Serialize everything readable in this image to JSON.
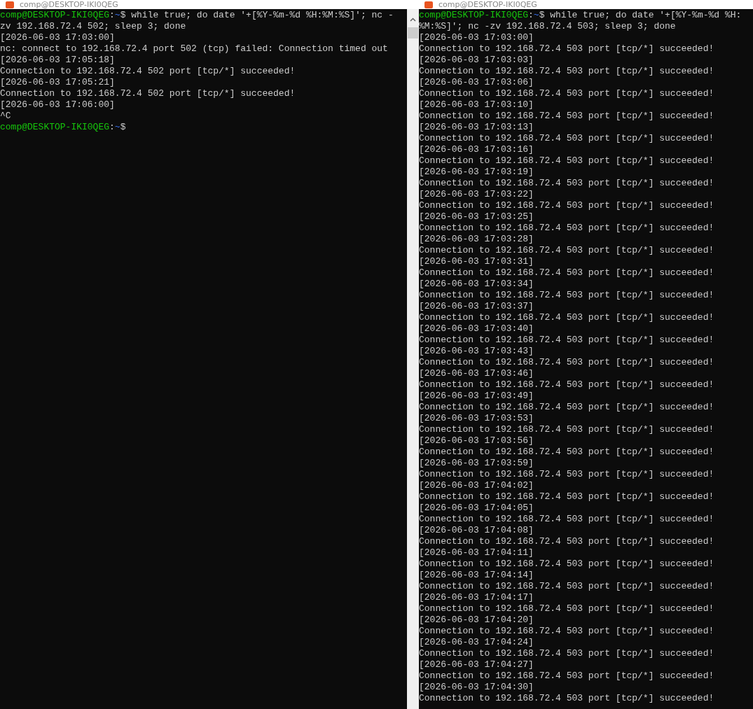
{
  "windows": [
    {
      "title": "comp@DESKTOP-IKI0QEG",
      "scrollbar": true,
      "lines": [
        {
          "kind": "prompt",
          "user_host": "comp@DESKTOP-IKI0QEG",
          "separator": ":",
          "path": "~",
          "symbol": "$",
          "command": "while true; do date '+[%Y-%m-%d %H:%M:%S]'; nc -"
        },
        {
          "kind": "output",
          "text": "zv 192.168.72.4 502; sleep 3; done"
        },
        {
          "kind": "output",
          "text": "[2026-06-03 17:03:00]"
        },
        {
          "kind": "output",
          "text": "nc: connect to 192.168.72.4 port 502 (tcp) failed: Connection timed out"
        },
        {
          "kind": "output",
          "text": "[2026-06-03 17:05:18]"
        },
        {
          "kind": "output",
          "text": "Connection to 192.168.72.4 502 port [tcp/*] succeeded!"
        },
        {
          "kind": "output",
          "text": "[2026-06-03 17:05:21]"
        },
        {
          "kind": "output",
          "text": "Connection to 192.168.72.4 502 port [tcp/*] succeeded!"
        },
        {
          "kind": "output",
          "text": "[2026-06-03 17:06:00]"
        },
        {
          "kind": "output",
          "text": "^C"
        },
        {
          "kind": "prompt",
          "user_host": "comp@DESKTOP-IKI0QEG",
          "separator": ":",
          "path": "~",
          "symbol": "$"
        }
      ]
    },
    {
      "title": "comp@DESKTOP-IKI0QEG",
      "scrollbar": false,
      "lines": [
        {
          "kind": "prompt",
          "user_host": "comp@DESKTOP-IKI0QEG",
          "separator": ":",
          "path": "~",
          "symbol": "$",
          "command": "while true; do date '+[%Y-%m-%d %H:"
        },
        {
          "kind": "output",
          "text": "%M:%S]'; nc -zv 192.168.72.4 503; sleep 3; done"
        },
        {
          "kind": "output",
          "text": "[2026-06-03 17:03:00]"
        },
        {
          "kind": "output",
          "text": "Connection to 192.168.72.4 503 port [tcp/*] succeeded!"
        },
        {
          "kind": "output",
          "text": "[2026-06-03 17:03:03]"
        },
        {
          "kind": "output",
          "text": "Connection to 192.168.72.4 503 port [tcp/*] succeeded!"
        },
        {
          "kind": "output",
          "text": "[2026-06-03 17:03:06]"
        },
        {
          "kind": "output",
          "text": "Connection to 192.168.72.4 503 port [tcp/*] succeeded!"
        },
        {
          "kind": "output",
          "text": "[2026-06-03 17:03:10]"
        },
        {
          "kind": "output",
          "text": "Connection to 192.168.72.4 503 port [tcp/*] succeeded!"
        },
        {
          "kind": "output",
          "text": "[2026-06-03 17:03:13]"
        },
        {
          "kind": "output",
          "text": "Connection to 192.168.72.4 503 port [tcp/*] succeeded!"
        },
        {
          "kind": "output",
          "text": "[2026-06-03 17:03:16]"
        },
        {
          "kind": "output",
          "text": "Connection to 192.168.72.4 503 port [tcp/*] succeeded!"
        },
        {
          "kind": "output",
          "text": "[2026-06-03 17:03:19]"
        },
        {
          "kind": "output",
          "text": "Connection to 192.168.72.4 503 port [tcp/*] succeeded!"
        },
        {
          "kind": "output",
          "text": "[2026-06-03 17:03:22]"
        },
        {
          "kind": "output",
          "text": "Connection to 192.168.72.4 503 port [tcp/*] succeeded!"
        },
        {
          "kind": "output",
          "text": "[2026-06-03 17:03:25]"
        },
        {
          "kind": "output",
          "text": "Connection to 192.168.72.4 503 port [tcp/*] succeeded!"
        },
        {
          "kind": "output",
          "text": "[2026-06-03 17:03:28]"
        },
        {
          "kind": "output",
          "text": "Connection to 192.168.72.4 503 port [tcp/*] succeeded!"
        },
        {
          "kind": "output",
          "text": "[2026-06-03 17:03:31]"
        },
        {
          "kind": "output",
          "text": "Connection to 192.168.72.4 503 port [tcp/*] succeeded!"
        },
        {
          "kind": "output",
          "text": "[2026-06-03 17:03:34]"
        },
        {
          "kind": "output",
          "text": "Connection to 192.168.72.4 503 port [tcp/*] succeeded!"
        },
        {
          "kind": "output",
          "text": "[2026-06-03 17:03:37]"
        },
        {
          "kind": "output",
          "text": "Connection to 192.168.72.4 503 port [tcp/*] succeeded!"
        },
        {
          "kind": "output",
          "text": "[2026-06-03 17:03:40]"
        },
        {
          "kind": "output",
          "text": "Connection to 192.168.72.4 503 port [tcp/*] succeeded!"
        },
        {
          "kind": "output",
          "text": "[2026-06-03 17:03:43]"
        },
        {
          "kind": "output",
          "text": "Connection to 192.168.72.4 503 port [tcp/*] succeeded!"
        },
        {
          "kind": "output",
          "text": "[2026-06-03 17:03:46]"
        },
        {
          "kind": "output",
          "text": "Connection to 192.168.72.4 503 port [tcp/*] succeeded!"
        },
        {
          "kind": "output",
          "text": "[2026-06-03 17:03:49]"
        },
        {
          "kind": "output",
          "text": "Connection to 192.168.72.4 503 port [tcp/*] succeeded!"
        },
        {
          "kind": "output",
          "text": "[2026-06-03 17:03:53]"
        },
        {
          "kind": "output",
          "text": "Connection to 192.168.72.4 503 port [tcp/*] succeeded!"
        },
        {
          "kind": "output",
          "text": "[2026-06-03 17:03:56]"
        },
        {
          "kind": "output",
          "text": "Connection to 192.168.72.4 503 port [tcp/*] succeeded!"
        },
        {
          "kind": "output",
          "text": "[2026-06-03 17:03:59]"
        },
        {
          "kind": "output",
          "text": "Connection to 192.168.72.4 503 port [tcp/*] succeeded!"
        },
        {
          "kind": "output",
          "text": "[2026-06-03 17:04:02]"
        },
        {
          "kind": "output",
          "text": "Connection to 192.168.72.4 503 port [tcp/*] succeeded!"
        },
        {
          "kind": "output",
          "text": "[2026-06-03 17:04:05]"
        },
        {
          "kind": "output",
          "text": "Connection to 192.168.72.4 503 port [tcp/*] succeeded!"
        },
        {
          "kind": "output",
          "text": "[2026-06-03 17:04:08]"
        },
        {
          "kind": "output",
          "text": "Connection to 192.168.72.4 503 port [tcp/*] succeeded!"
        },
        {
          "kind": "output",
          "text": "[2026-06-03 17:04:11]"
        },
        {
          "kind": "output",
          "text": "Connection to 192.168.72.4 503 port [tcp/*] succeeded!"
        },
        {
          "kind": "output",
          "text": "[2026-06-03 17:04:14]"
        },
        {
          "kind": "output",
          "text": "Connection to 192.168.72.4 503 port [tcp/*] succeeded!"
        },
        {
          "kind": "output",
          "text": "[2026-06-03 17:04:17]"
        },
        {
          "kind": "output",
          "text": "Connection to 192.168.72.4 503 port [tcp/*] succeeded!"
        },
        {
          "kind": "output",
          "text": "[2026-06-03 17:04:20]"
        },
        {
          "kind": "output",
          "text": "Connection to 192.168.72.4 503 port [tcp/*] succeeded!"
        },
        {
          "kind": "output",
          "text": "[2026-06-03 17:04:24]"
        },
        {
          "kind": "output",
          "text": "Connection to 192.168.72.4 503 port [tcp/*] succeeded!"
        },
        {
          "kind": "output",
          "text": "[2026-06-03 17:04:27]"
        },
        {
          "kind": "output",
          "text": "Connection to 192.168.72.4 503 port [tcp/*] succeeded!"
        },
        {
          "kind": "output",
          "text": "[2026-06-03 17:04:30]"
        },
        {
          "kind": "output",
          "text": "Connection to 192.168.72.4 503 port [tcp/*] succeeded!"
        }
      ]
    }
  ]
}
